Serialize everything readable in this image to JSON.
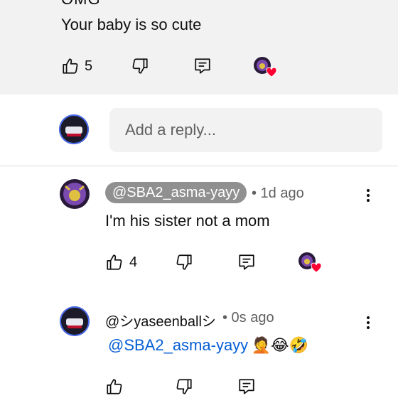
{
  "top_comment": {
    "text": "Your baby is so cute",
    "like_count": "5"
  },
  "reply_input": {
    "placeholder": "Add a reply..."
  },
  "reply1": {
    "handle": "@SBA2_asma-yayy",
    "time": "• 1d ago",
    "text": "I'm his sister not a mom",
    "like_count": "4"
  },
  "reply2": {
    "handle": "@シyaseenballシ",
    "time": "• 0s ago",
    "mention": "@SBA2_asma-yayy",
    "emojis": "🤦😂🤣"
  },
  "colors": {
    "accent": "#065fd4",
    "heart": "#ff0033",
    "surface": "#f2f2f2"
  }
}
